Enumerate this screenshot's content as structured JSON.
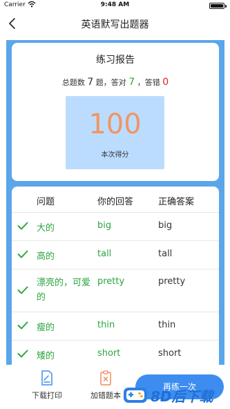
{
  "status_bar": {
    "carrier": "Carrier",
    "time": "9:48 AM"
  },
  "nav": {
    "title": "英语默写出题器"
  },
  "report": {
    "title": "练习报告",
    "summary": {
      "total_prefix": "总题数",
      "total": "7",
      "total_suffix": "题，答对",
      "correct": "7",
      "sep": "，答错",
      "wrong": "0"
    },
    "score": "100",
    "score_label": "本次得分",
    "colors": {
      "score": "#f19561",
      "correct": "#2aa640",
      "wrong": "#e02424",
      "panel": "#5ba6ea"
    }
  },
  "table": {
    "headers": [
      "问题",
      "你的回答",
      "正确答案"
    ],
    "rows": [
      {
        "question": "大的",
        "answer": "big",
        "correct": "big",
        "status_icon": "check-icon"
      },
      {
        "question": "高的",
        "answer": "tall",
        "correct": "tall",
        "status_icon": "check-icon"
      },
      {
        "question": "漂亮的，可爱的",
        "answer": "pretty",
        "correct": "pretty",
        "status_icon": "check-icon"
      },
      {
        "question": "瘦的",
        "answer": "thin",
        "correct": "thin",
        "status_icon": "check-icon"
      },
      {
        "question": "矮的",
        "answer": "short",
        "correct": "short",
        "status_icon": "check-icon"
      }
    ]
  },
  "bottom": {
    "download_label": "下载打印",
    "download_icon": "document-icon",
    "wrongbook_label": "加错题本",
    "wrongbook_icon": "wrong-book-icon",
    "retry_label": "再练一次"
  },
  "watermark": {
    "text": "8D后下载",
    "icon": "gamepad-icon"
  }
}
